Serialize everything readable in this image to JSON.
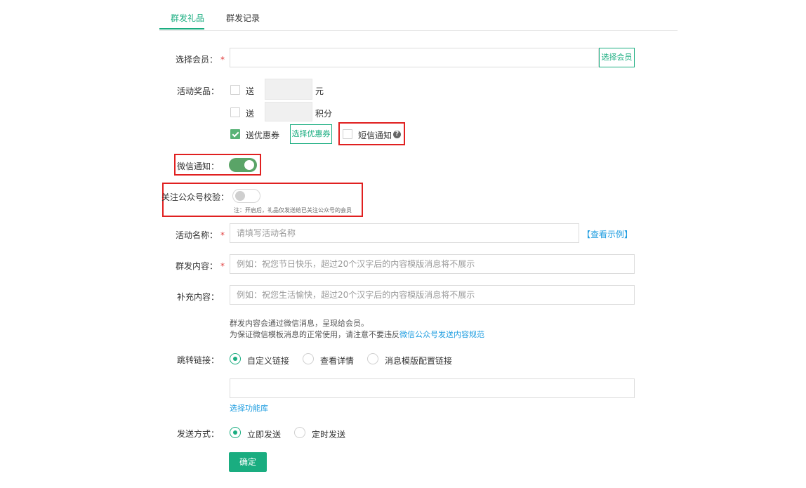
{
  "tabs": [
    {
      "label": "群发礼品"
    },
    {
      "label": "群发记录"
    }
  ],
  "member": {
    "label": "选择会员：",
    "required_mark": "*",
    "input_value": "",
    "button_label": "选择会员"
  },
  "prize": {
    "label": "活动奖品：",
    "cash": {
      "checkbox_label": "送",
      "value": "",
      "unit": "元",
      "checked": false
    },
    "points": {
      "checkbox_label": "送",
      "value": "",
      "unit": "积分",
      "checked": false
    },
    "coupon": {
      "checkbox_label": "送优惠券",
      "checked": true,
      "button_label": "选择优惠券"
    },
    "sms": {
      "checkbox_label": "短信通知",
      "checked": false,
      "help_icon_glyph": "?"
    }
  },
  "wechat_notify": {
    "label": "微信通知：",
    "enabled": true
  },
  "follow_check": {
    "label": "关注公众号校验：",
    "enabled": false,
    "note": "注：开启后，礼品仅发送给已关注公众号的会员"
  },
  "activity_name": {
    "label": "活动名称：",
    "required_mark": "*",
    "placeholder": "请填写活动名称",
    "example_link": "【查看示例】"
  },
  "mass_content": {
    "label": "群发内容：",
    "required_mark": "*",
    "placeholder": "例如：祝您节日快乐，超过20个汉字后的内容模版消息将不展示"
  },
  "extra_content": {
    "label": "补充内容：",
    "placeholder": "例如：祝您生活愉快，超过20个汉字后的内容模版消息将不展示"
  },
  "hint": {
    "line1": "群发内容会通过微信消息，呈现给会员。",
    "line2_prefix": "为保证微信模板消息的正常使用，请注意不要违反",
    "line2_link": "微信公众号发送内容规范"
  },
  "jump_link": {
    "label": "跳转链接：",
    "options": [
      "自定义链接",
      "查看详情",
      "消息模版配置链接"
    ],
    "selected": "自定义链接",
    "input_value": "",
    "function_link": "选择功能库"
  },
  "send_mode": {
    "label": "发送方式：",
    "options": [
      "立即发送",
      "定时发送"
    ],
    "selected": "立即发送"
  },
  "confirm_button": "确定",
  "colors": {
    "accent": "#1aad80",
    "toggle_on": "#5aa467",
    "checkbox_checked": "#59b377",
    "highlight_box": "#e02020",
    "required": "#e03d3d",
    "link": "#1e9de0"
  }
}
